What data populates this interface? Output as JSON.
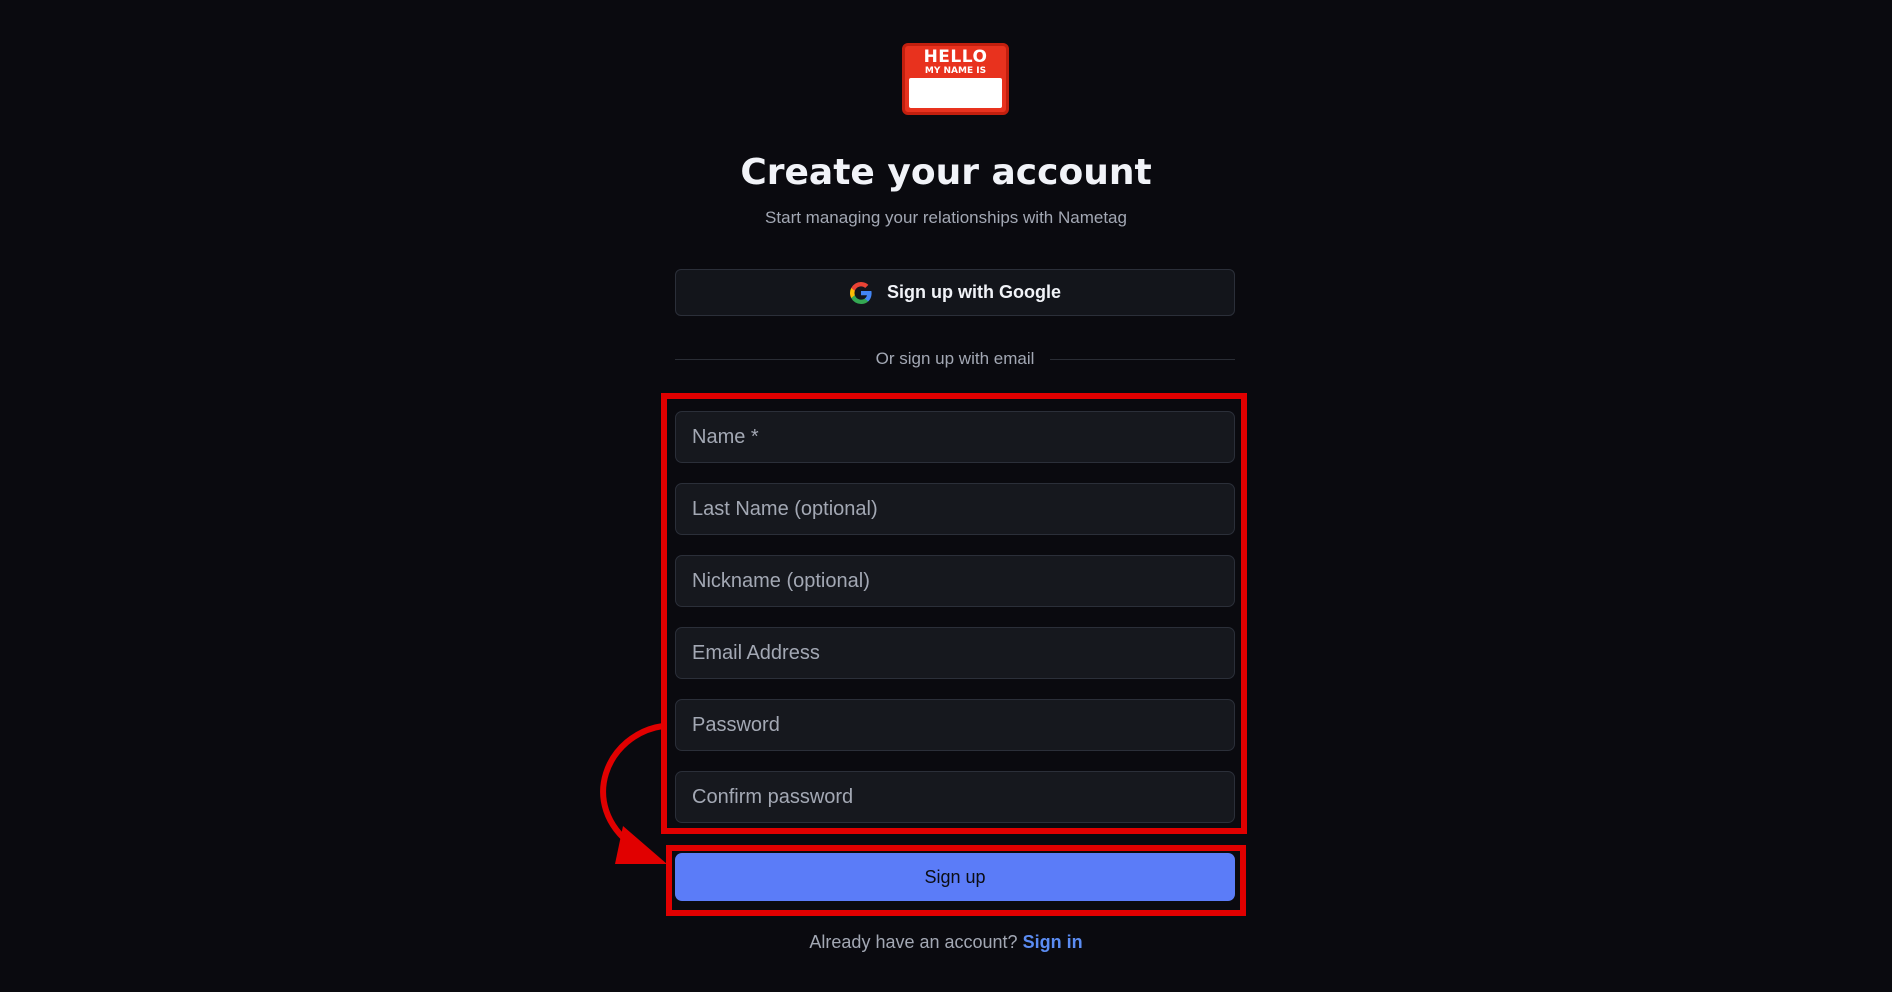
{
  "logo": {
    "line1": "HELLO",
    "line2": "MY NAME IS"
  },
  "header": {
    "title": "Create your account",
    "subtitle": "Start managing your relationships with Nametag"
  },
  "google": {
    "label": "Sign up with Google",
    "icon": "google-g-icon"
  },
  "divider": {
    "text": "Or sign up with email"
  },
  "form": {
    "fields": [
      {
        "placeholder": "Name *",
        "value": ""
      },
      {
        "placeholder": "Last Name (optional)",
        "value": ""
      },
      {
        "placeholder": "Nickname (optional)",
        "value": ""
      },
      {
        "placeholder": "Email Address",
        "value": ""
      },
      {
        "placeholder": "Password",
        "value": ""
      },
      {
        "placeholder": "Confirm password",
        "value": ""
      }
    ],
    "submit_label": "Sign up"
  },
  "footer": {
    "prompt": "Already have an account?",
    "link": "Sign in"
  },
  "colors": {
    "background": "#0a0a0f",
    "accent": "#5b7cf8",
    "link": "#5b8cf2",
    "annotation": "#e10000",
    "logo_red": "#e8321e"
  }
}
